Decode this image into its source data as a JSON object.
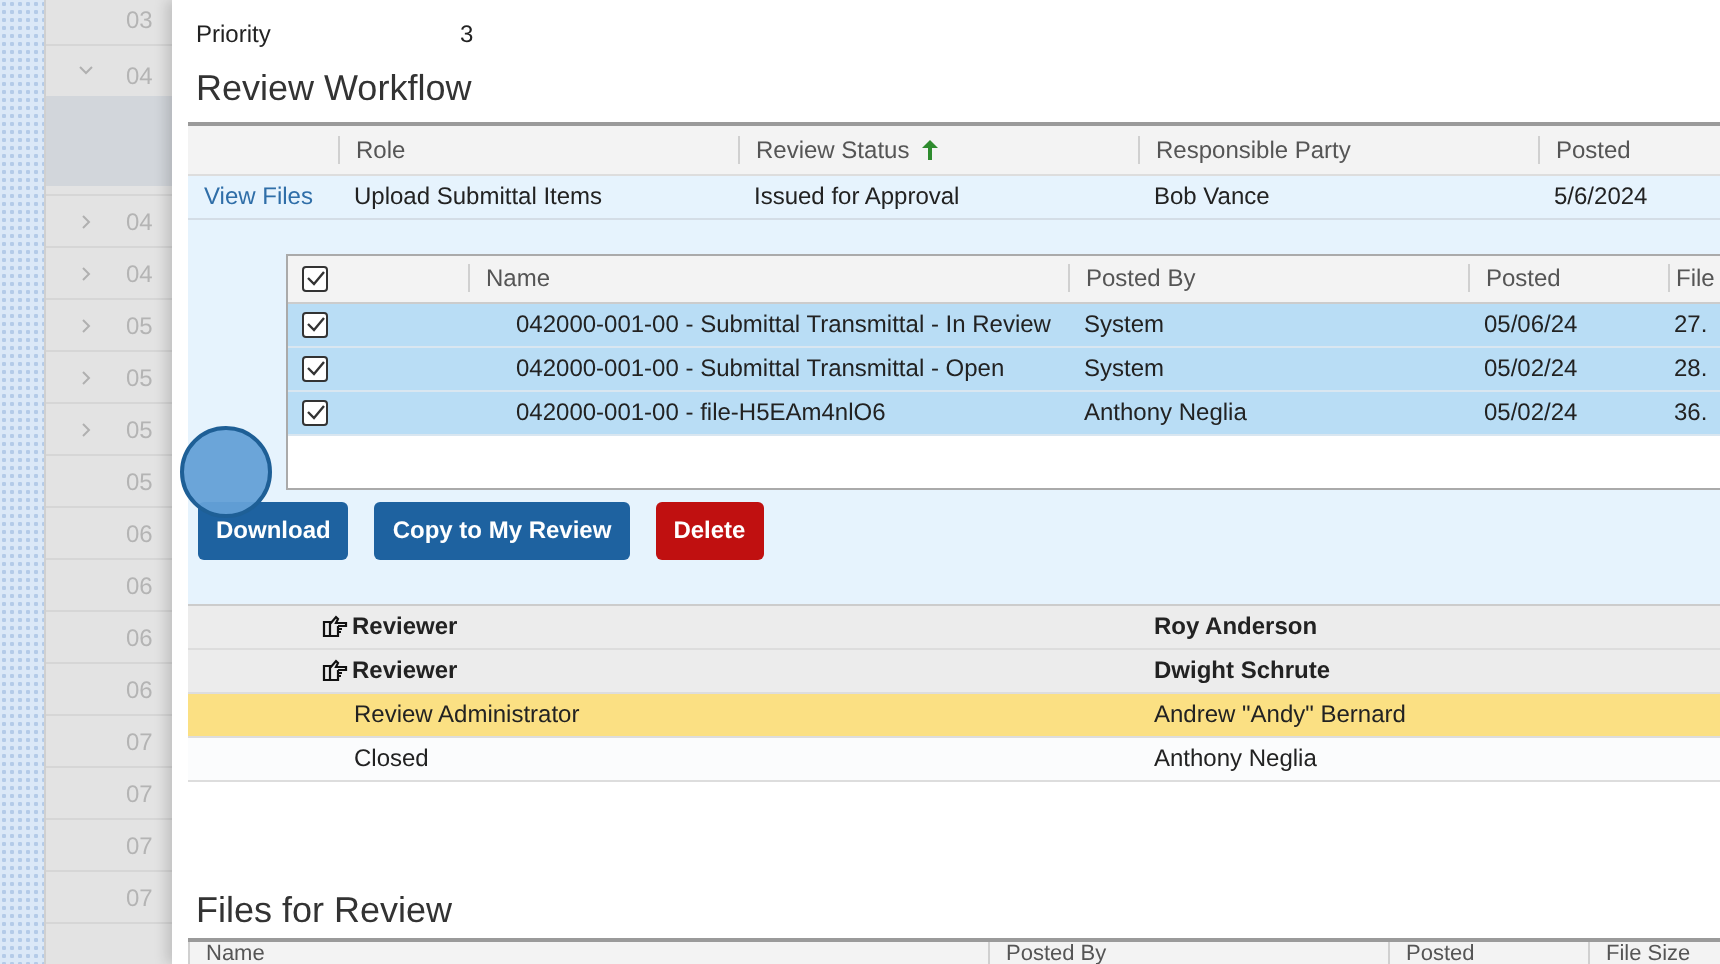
{
  "background_list": [
    {
      "text": "03",
      "kind": "leaf"
    },
    {
      "text": "04",
      "kind": "expanded"
    },
    {
      "text": "04",
      "kind": "collapsed"
    },
    {
      "text": "04",
      "kind": "collapsed"
    },
    {
      "text": "05",
      "kind": "collapsed"
    },
    {
      "text": "05",
      "kind": "collapsed"
    },
    {
      "text": "05",
      "kind": "collapsed"
    },
    {
      "text": "05",
      "kind": "leaf"
    },
    {
      "text": "06",
      "kind": "leaf"
    },
    {
      "text": "06",
      "kind": "leaf"
    },
    {
      "text": "06",
      "kind": "leaf"
    },
    {
      "text": "06",
      "kind": "leaf"
    },
    {
      "text": "07",
      "kind": "leaf"
    },
    {
      "text": "07",
      "kind": "leaf"
    },
    {
      "text": "07",
      "kind": "leaf"
    },
    {
      "text": "07",
      "kind": "leaf"
    }
  ],
  "priority": {
    "label": "Priority",
    "value": "3"
  },
  "review_workflow": {
    "title": "Review Workflow",
    "columns": [
      {
        "label": "Role",
        "sorted": false
      },
      {
        "label": "Review Status",
        "sorted": true
      },
      {
        "label": "Responsible Party",
        "sorted": false
      },
      {
        "label": "Posted",
        "sorted": false
      }
    ],
    "main_row": {
      "link": "View Files",
      "role": "Upload Submittal Items",
      "status": "Issued for Approval",
      "party": "Bob Vance",
      "posted": "5/6/2024"
    },
    "files": {
      "select_all_checked": true,
      "columns": [
        "Name",
        "Posted By",
        "Posted",
        "File"
      ],
      "rows": [
        {
          "checked": true,
          "name": "042000-001-00 - Submittal Transmittal - In Review",
          "posted_by": "System",
          "posted": "05/06/24",
          "size": "27."
        },
        {
          "checked": true,
          "name": "042000-001-00 - Submittal Transmittal - Open",
          "posted_by": "System",
          "posted": "05/02/24",
          "size": "28."
        },
        {
          "checked": true,
          "name": "042000-001-00 - file-H5EAm4nlO6",
          "posted_by": "Anthony Neglia",
          "posted": "05/02/24",
          "size": "36."
        }
      ]
    },
    "buttons": [
      {
        "label": "Download",
        "kind": "primary"
      },
      {
        "label": "Copy to My Review",
        "kind": "primary"
      },
      {
        "label": "Delete",
        "kind": "danger"
      }
    ],
    "steps": [
      {
        "kind": "reviewer",
        "role": "Reviewer",
        "party": "Roy Anderson",
        "selected": false
      },
      {
        "kind": "reviewer",
        "role": "Reviewer",
        "party": "Dwight Schrute",
        "selected": false
      },
      {
        "kind": "plain",
        "role": "Review Administrator",
        "party": "Andrew \"Andy\" Bernard",
        "selected": true
      },
      {
        "kind": "plain",
        "role": "Closed",
        "party": "Anthony Neglia",
        "selected": false
      }
    ]
  },
  "files_for_review": {
    "title": "Files for Review",
    "columns": [
      "Name",
      "Posted By",
      "Posted",
      "File Size"
    ]
  }
}
